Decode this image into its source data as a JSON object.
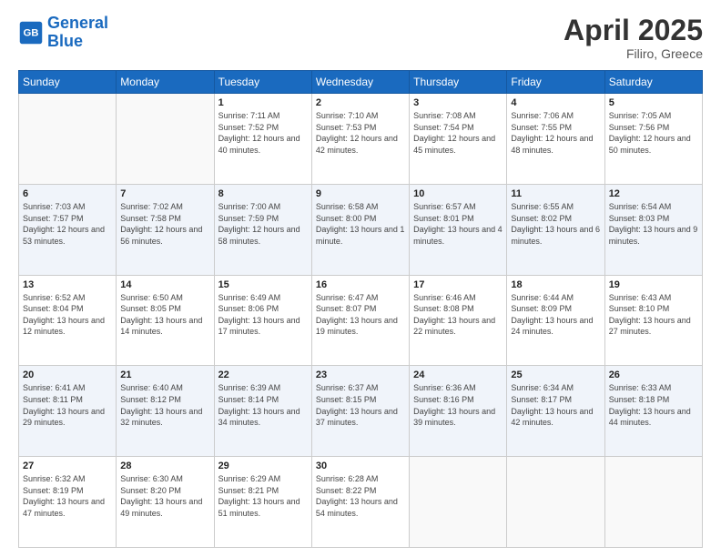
{
  "header": {
    "logo_line1": "General",
    "logo_line2": "Blue",
    "month": "April 2025",
    "location": "Filiro, Greece"
  },
  "days_of_week": [
    "Sunday",
    "Monday",
    "Tuesday",
    "Wednesday",
    "Thursday",
    "Friday",
    "Saturday"
  ],
  "weeks": [
    [
      {
        "day": "",
        "sunrise": "",
        "sunset": "",
        "daylight": ""
      },
      {
        "day": "",
        "sunrise": "",
        "sunset": "",
        "daylight": ""
      },
      {
        "day": "1",
        "sunrise": "Sunrise: 7:11 AM",
        "sunset": "Sunset: 7:52 PM",
        "daylight": "Daylight: 12 hours and 40 minutes."
      },
      {
        "day": "2",
        "sunrise": "Sunrise: 7:10 AM",
        "sunset": "Sunset: 7:53 PM",
        "daylight": "Daylight: 12 hours and 42 minutes."
      },
      {
        "day": "3",
        "sunrise": "Sunrise: 7:08 AM",
        "sunset": "Sunset: 7:54 PM",
        "daylight": "Daylight: 12 hours and 45 minutes."
      },
      {
        "day": "4",
        "sunrise": "Sunrise: 7:06 AM",
        "sunset": "Sunset: 7:55 PM",
        "daylight": "Daylight: 12 hours and 48 minutes."
      },
      {
        "day": "5",
        "sunrise": "Sunrise: 7:05 AM",
        "sunset": "Sunset: 7:56 PM",
        "daylight": "Daylight: 12 hours and 50 minutes."
      }
    ],
    [
      {
        "day": "6",
        "sunrise": "Sunrise: 7:03 AM",
        "sunset": "Sunset: 7:57 PM",
        "daylight": "Daylight: 12 hours and 53 minutes."
      },
      {
        "day": "7",
        "sunrise": "Sunrise: 7:02 AM",
        "sunset": "Sunset: 7:58 PM",
        "daylight": "Daylight: 12 hours and 56 minutes."
      },
      {
        "day": "8",
        "sunrise": "Sunrise: 7:00 AM",
        "sunset": "Sunset: 7:59 PM",
        "daylight": "Daylight: 12 hours and 58 minutes."
      },
      {
        "day": "9",
        "sunrise": "Sunrise: 6:58 AM",
        "sunset": "Sunset: 8:00 PM",
        "daylight": "Daylight: 13 hours and 1 minute."
      },
      {
        "day": "10",
        "sunrise": "Sunrise: 6:57 AM",
        "sunset": "Sunset: 8:01 PM",
        "daylight": "Daylight: 13 hours and 4 minutes."
      },
      {
        "day": "11",
        "sunrise": "Sunrise: 6:55 AM",
        "sunset": "Sunset: 8:02 PM",
        "daylight": "Daylight: 13 hours and 6 minutes."
      },
      {
        "day": "12",
        "sunrise": "Sunrise: 6:54 AM",
        "sunset": "Sunset: 8:03 PM",
        "daylight": "Daylight: 13 hours and 9 minutes."
      }
    ],
    [
      {
        "day": "13",
        "sunrise": "Sunrise: 6:52 AM",
        "sunset": "Sunset: 8:04 PM",
        "daylight": "Daylight: 13 hours and 12 minutes."
      },
      {
        "day": "14",
        "sunrise": "Sunrise: 6:50 AM",
        "sunset": "Sunset: 8:05 PM",
        "daylight": "Daylight: 13 hours and 14 minutes."
      },
      {
        "day": "15",
        "sunrise": "Sunrise: 6:49 AM",
        "sunset": "Sunset: 8:06 PM",
        "daylight": "Daylight: 13 hours and 17 minutes."
      },
      {
        "day": "16",
        "sunrise": "Sunrise: 6:47 AM",
        "sunset": "Sunset: 8:07 PM",
        "daylight": "Daylight: 13 hours and 19 minutes."
      },
      {
        "day": "17",
        "sunrise": "Sunrise: 6:46 AM",
        "sunset": "Sunset: 8:08 PM",
        "daylight": "Daylight: 13 hours and 22 minutes."
      },
      {
        "day": "18",
        "sunrise": "Sunrise: 6:44 AM",
        "sunset": "Sunset: 8:09 PM",
        "daylight": "Daylight: 13 hours and 24 minutes."
      },
      {
        "day": "19",
        "sunrise": "Sunrise: 6:43 AM",
        "sunset": "Sunset: 8:10 PM",
        "daylight": "Daylight: 13 hours and 27 minutes."
      }
    ],
    [
      {
        "day": "20",
        "sunrise": "Sunrise: 6:41 AM",
        "sunset": "Sunset: 8:11 PM",
        "daylight": "Daylight: 13 hours and 29 minutes."
      },
      {
        "day": "21",
        "sunrise": "Sunrise: 6:40 AM",
        "sunset": "Sunset: 8:12 PM",
        "daylight": "Daylight: 13 hours and 32 minutes."
      },
      {
        "day": "22",
        "sunrise": "Sunrise: 6:39 AM",
        "sunset": "Sunset: 8:14 PM",
        "daylight": "Daylight: 13 hours and 34 minutes."
      },
      {
        "day": "23",
        "sunrise": "Sunrise: 6:37 AM",
        "sunset": "Sunset: 8:15 PM",
        "daylight": "Daylight: 13 hours and 37 minutes."
      },
      {
        "day": "24",
        "sunrise": "Sunrise: 6:36 AM",
        "sunset": "Sunset: 8:16 PM",
        "daylight": "Daylight: 13 hours and 39 minutes."
      },
      {
        "day": "25",
        "sunrise": "Sunrise: 6:34 AM",
        "sunset": "Sunset: 8:17 PM",
        "daylight": "Daylight: 13 hours and 42 minutes."
      },
      {
        "day": "26",
        "sunrise": "Sunrise: 6:33 AM",
        "sunset": "Sunset: 8:18 PM",
        "daylight": "Daylight: 13 hours and 44 minutes."
      }
    ],
    [
      {
        "day": "27",
        "sunrise": "Sunrise: 6:32 AM",
        "sunset": "Sunset: 8:19 PM",
        "daylight": "Daylight: 13 hours and 47 minutes."
      },
      {
        "day": "28",
        "sunrise": "Sunrise: 6:30 AM",
        "sunset": "Sunset: 8:20 PM",
        "daylight": "Daylight: 13 hours and 49 minutes."
      },
      {
        "day": "29",
        "sunrise": "Sunrise: 6:29 AM",
        "sunset": "Sunset: 8:21 PM",
        "daylight": "Daylight: 13 hours and 51 minutes."
      },
      {
        "day": "30",
        "sunrise": "Sunrise: 6:28 AM",
        "sunset": "Sunset: 8:22 PM",
        "daylight": "Daylight: 13 hours and 54 minutes."
      },
      {
        "day": "",
        "sunrise": "",
        "sunset": "",
        "daylight": ""
      },
      {
        "day": "",
        "sunrise": "",
        "sunset": "",
        "daylight": ""
      },
      {
        "day": "",
        "sunrise": "",
        "sunset": "",
        "daylight": ""
      }
    ]
  ]
}
